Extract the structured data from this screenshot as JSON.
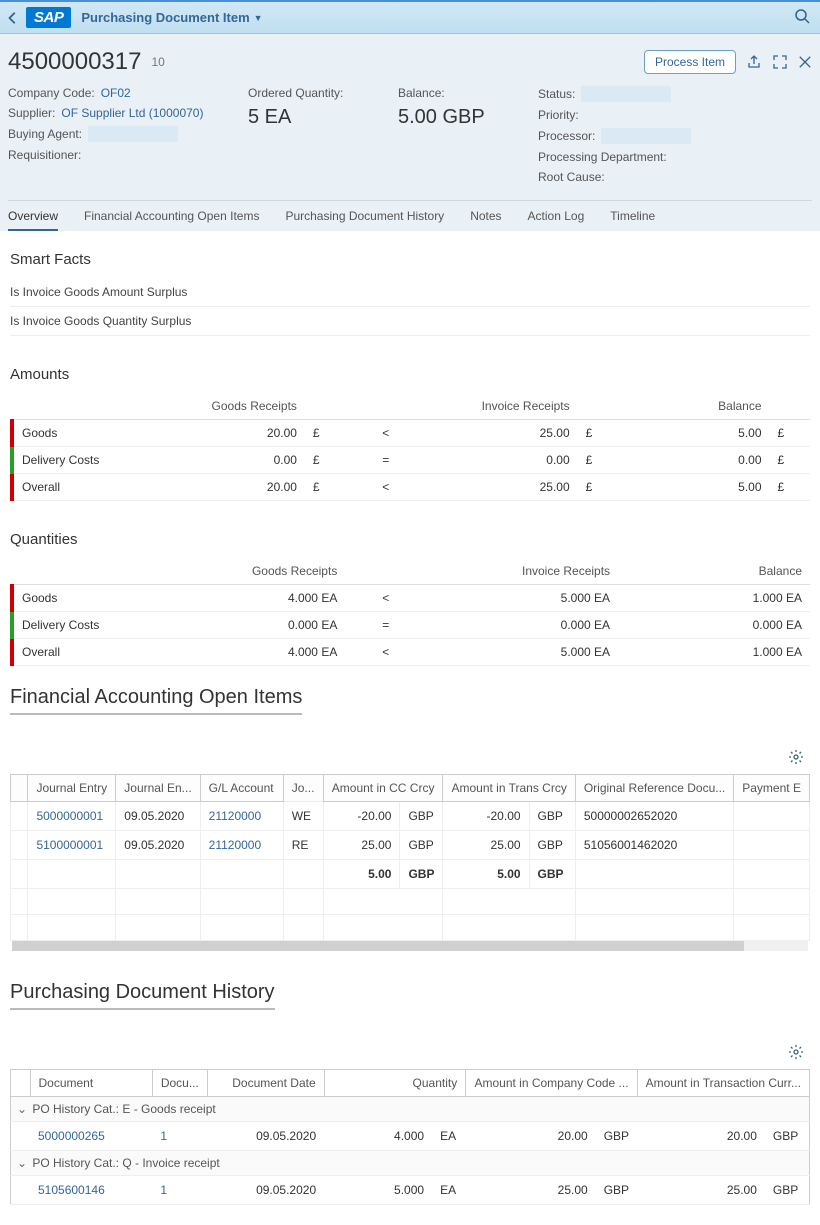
{
  "shell": {
    "title": "Purchasing Document Item"
  },
  "header": {
    "id": "4500000317",
    "item": "10",
    "process_btn": "Process Item",
    "col1": {
      "company_code_label": "Company Code:",
      "company_code": "OF02",
      "supplier_label": "Supplier:",
      "supplier": "OF Supplier Ltd (1000070)",
      "buying_agent_label": "Buying Agent:",
      "requisitioner_label": "Requisitioner:"
    },
    "col2": {
      "ordered_qty_label": "Ordered Quantity:",
      "ordered_qty": "5 EA"
    },
    "col3": {
      "balance_label": "Balance:",
      "balance": "5.00  GBP"
    },
    "col4": {
      "status_label": "Status:",
      "priority_label": "Priority:",
      "processor_label": "Processor:",
      "dept_label": "Processing Department:",
      "root_label": "Root Cause:"
    }
  },
  "tabs": [
    "Overview",
    "Financial Accounting Open Items",
    "Purchasing Document History",
    "Notes",
    "Action Log",
    "Timeline"
  ],
  "smartfacts": {
    "title": "Smart Facts",
    "items": [
      "Is Invoice Goods Amount Surplus",
      "Is Invoice Goods Quantity Surplus"
    ]
  },
  "amounts": {
    "title": "Amounts",
    "headers": [
      "",
      "Goods Receipts",
      "",
      "",
      "Invoice Receipts",
      "",
      "Balance",
      ""
    ],
    "rows": [
      {
        "label": "Goods",
        "gr": "20.00",
        "gru": "£",
        "op": "<",
        "ir": "25.00",
        "iru": "£",
        "bal": "5.00",
        "balu": "£",
        "c": "red"
      },
      {
        "label": "Delivery Costs",
        "gr": "0.00",
        "gru": "£",
        "op": "=",
        "ir": "0.00",
        "iru": "£",
        "bal": "0.00",
        "balu": "£",
        "c": "green"
      },
      {
        "label": "Overall",
        "gr": "20.00",
        "gru": "£",
        "op": "<",
        "ir": "25.00",
        "iru": "£",
        "bal": "5.00",
        "balu": "£",
        "c": "red"
      }
    ]
  },
  "quantities": {
    "title": "Quantities",
    "headers": [
      "",
      "Goods Receipts",
      "",
      "Invoice Receipts",
      "Balance"
    ],
    "rows": [
      {
        "label": "Goods",
        "gr": "4.000 EA",
        "op": "<",
        "ir": "5.000 EA",
        "bal": "1.000 EA",
        "c": "red"
      },
      {
        "label": "Delivery Costs",
        "gr": "0.000 EA",
        "op": "=",
        "ir": "0.000 EA",
        "bal": "0.000 EA",
        "c": "green"
      },
      {
        "label": "Overall",
        "gr": "4.000 EA",
        "op": "<",
        "ir": "5.000 EA",
        "bal": "1.000 EA",
        "c": "red"
      }
    ]
  },
  "fai": {
    "title": "Financial Accounting Open Items",
    "headers": [
      "Journal Entry",
      "Journal En...",
      "G/L Account",
      "Jo...",
      "Amount in CC Crcy",
      "Amount in Trans Crcy",
      "Original Reference Docu...",
      "Payment E"
    ],
    "rows": [
      {
        "je": "5000000001",
        "date": "09.05.2020",
        "gl": "21120000",
        "type": "WE",
        "cc": "-20.00",
        "ccu": "GBP",
        "tr": "-20.00",
        "tru": "GBP",
        "ref": "50000002652020"
      },
      {
        "je": "5100000001",
        "date": "09.05.2020",
        "gl": "21120000",
        "type": "RE",
        "cc": "25.00",
        "ccu": "GBP",
        "tr": "25.00",
        "tru": "GBP",
        "ref": "51056001462020"
      }
    ],
    "sum": {
      "cc": "5.00",
      "ccu": "GBP",
      "tr": "5.00",
      "tru": "GBP"
    }
  },
  "pdh": {
    "title": "Purchasing Document History",
    "headers": [
      "Document",
      "Docu...",
      "Document Date",
      "Quantity",
      "Amount in Company Code ...",
      "Amount in Transaction Curr..."
    ],
    "groups": [
      {
        "label": "PO History Cat.: E - Goods receipt",
        "rows": [
          {
            "doc": "5000000265",
            "item": "1",
            "date": "09.05.2020",
            "qty": "4.000",
            "qtyu": "EA",
            "acc": "20.00",
            "accu": "GBP",
            "atc": "20.00",
            "atcu": "GBP"
          }
        ]
      },
      {
        "label": "PO History Cat.: Q - Invoice receipt",
        "rows": [
          {
            "doc": "5105600146",
            "item": "1",
            "date": "09.05.2020",
            "qty": "5.000",
            "qtyu": "EA",
            "acc": "25.00",
            "accu": "GBP",
            "atc": "25.00",
            "atcu": "GBP"
          }
        ]
      }
    ]
  }
}
